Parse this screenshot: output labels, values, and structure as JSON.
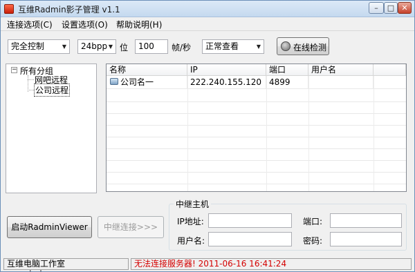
{
  "window": {
    "title": "互维Radmin影子管理 v1.1",
    "minimize": "–",
    "maximize": "□",
    "close": "✕"
  },
  "menu": {
    "connection": "连接选项(C)",
    "settings": "设置选项(O)",
    "help": "帮助说明(H)"
  },
  "toolbar": {
    "control_mode": "完全控制",
    "color_depth": "24bpp",
    "color_depth_unit": "位",
    "fps": "100",
    "fps_unit": "帧/秒",
    "view_mode": "正常查看",
    "online_check": "在线检测"
  },
  "tree": {
    "root": "所有分组",
    "children": [
      "网吧远程",
      "公司远程"
    ]
  },
  "list": {
    "columns": [
      "名称",
      "IP",
      "端口",
      "用户名"
    ],
    "rows": [
      {
        "name": "公司名一",
        "ip": "222.240.155.120",
        "port": "4899",
        "user": ""
      }
    ]
  },
  "buttons": {
    "start_viewer": "启动RadminViewer",
    "relay_connect": "中继连接>>>"
  },
  "relay": {
    "title": "中继主机",
    "ip_label": "IP地址:",
    "port_label": "端口:",
    "user_label": "用户名:",
    "password_label": "密码:",
    "ip_value": "",
    "port_value": "",
    "user_value": "",
    "password_value": ""
  },
  "status": {
    "studio": "互维电脑工作室 www.hnhv.com",
    "message": "无法连接服务器! 2011-06-16 16:41:24",
    "message_color": "#d40000"
  }
}
